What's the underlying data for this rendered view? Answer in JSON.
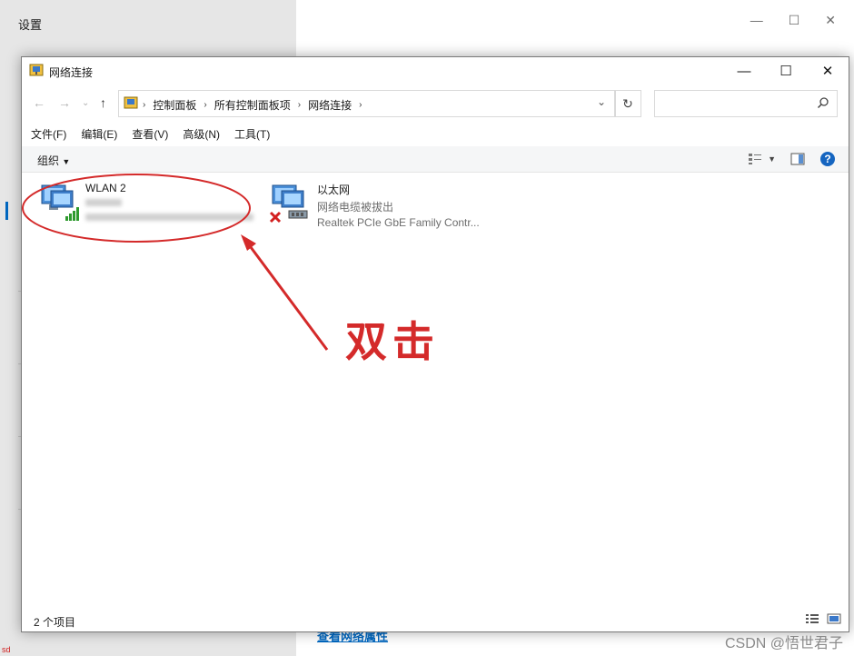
{
  "background": {
    "settings_title": "设置",
    "settings_link": "查看网络属性",
    "watermark_left": "sd",
    "csdn_watermark": "CSDN @悟世君子"
  },
  "window": {
    "title": "网络连接",
    "controls": [
      "—",
      "☐",
      "✕"
    ]
  },
  "nav": {
    "breadcrumbs": [
      "控制面板",
      "所有控制面板项",
      "网络连接"
    ],
    "refresh_icon": "refresh-icon",
    "search_placeholder": ""
  },
  "menu": [
    "文件(F)",
    "编辑(E)",
    "查看(V)",
    "高级(N)",
    "工具(T)"
  ],
  "commands": {
    "organize": "组织"
  },
  "connections": [
    {
      "name": "WLAN 2",
      "status": "",
      "adapter": ""
    },
    {
      "name": "以太网",
      "status": "网络电缆被拔出",
      "adapter": "Realtek PCIe GbE Family Contr..."
    }
  ],
  "status": {
    "count": "2 个项目"
  },
  "annotation": {
    "label": "双击",
    "color": "#d42a2a"
  },
  "colors": {
    "accent": "#0067c0",
    "annotation": "#d42a2a"
  }
}
